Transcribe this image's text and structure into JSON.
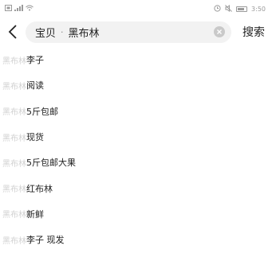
{
  "status_bar": {
    "time": "3:50",
    "icons": [
      "sim-icon",
      "signal-icon",
      "wifi-icon",
      "alarm-icon",
      "mute-icon",
      "battery-icon"
    ]
  },
  "search": {
    "category_label": "宝贝",
    "separator": "·",
    "query": "黑布林",
    "submit_label": "搜索"
  },
  "suggestions": [
    {
      "prefix": "黑布林",
      "rest": "李子"
    },
    {
      "prefix": "黑布林",
      "rest": " 阅读"
    },
    {
      "prefix": "黑布林",
      "rest": "5斤包邮"
    },
    {
      "prefix": "黑布林",
      "rest": " 现货"
    },
    {
      "prefix": "黑布林",
      "rest": "5斤包邮大果"
    },
    {
      "prefix": "黑布林",
      "rest": "红布林"
    },
    {
      "prefix": "黑布林",
      "rest": " 新鲜"
    },
    {
      "prefix": "黑布林",
      "rest": "李子 现发"
    }
  ]
}
